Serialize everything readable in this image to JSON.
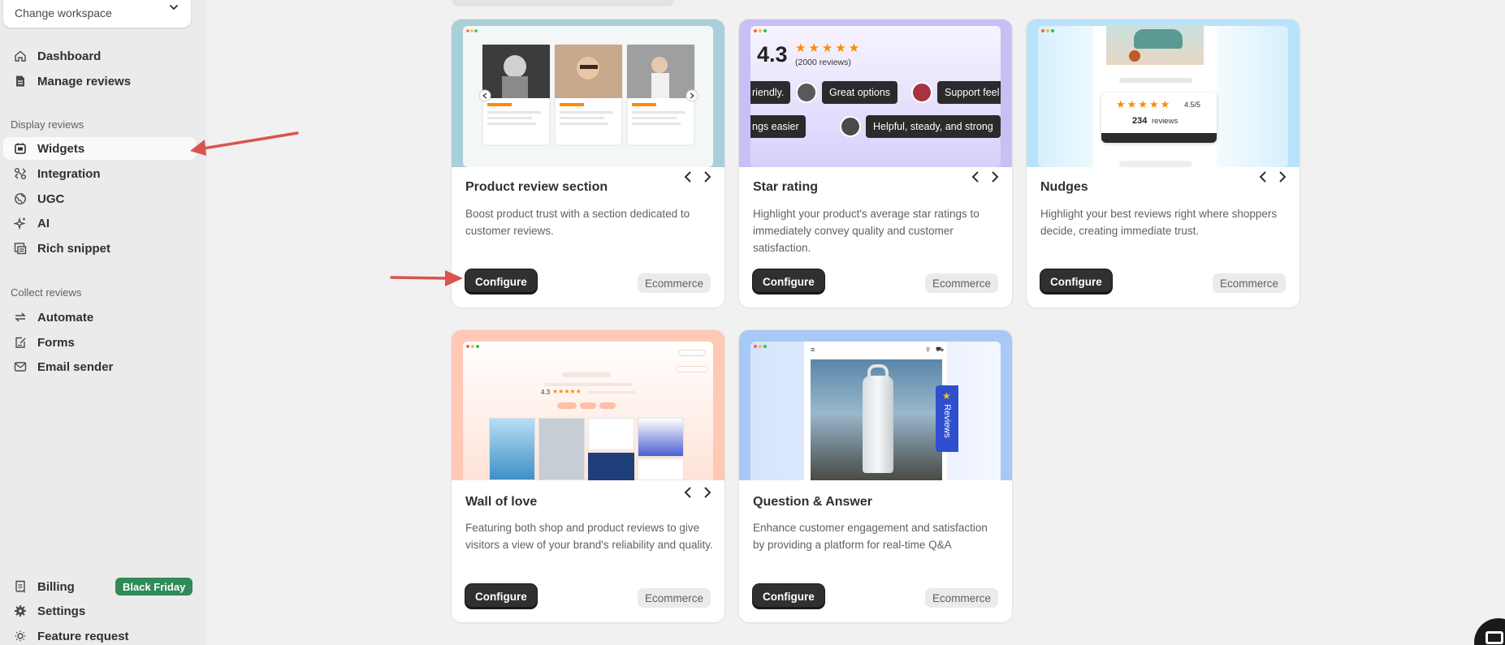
{
  "workspace": {
    "label": "Change workspace"
  },
  "sidebar": {
    "items_top": [
      {
        "label": "Dashboard",
        "icon": "home-icon"
      },
      {
        "label": "Manage reviews",
        "icon": "document-icon"
      }
    ],
    "display_title": "Display reviews",
    "display_items": [
      {
        "label": "Widgets",
        "icon": "widget-icon"
      },
      {
        "label": "Integration",
        "icon": "integration-icon"
      },
      {
        "label": "UGC",
        "icon": "globe-icon"
      },
      {
        "label": "AI",
        "icon": "sparkle-icon"
      },
      {
        "label": "Rich snippet",
        "icon": "snippet-icon"
      }
    ],
    "collect_title": "Collect reviews",
    "collect_items": [
      {
        "label": "Automate",
        "icon": "automate-icon"
      },
      {
        "label": "Forms",
        "icon": "form-icon"
      },
      {
        "label": "Email sender",
        "icon": "email-icon"
      }
    ],
    "bottom_items": [
      {
        "label": "Billing",
        "icon": "billing-icon"
      },
      {
        "label": "Settings",
        "icon": "gear-icon"
      },
      {
        "label": "Feature request",
        "icon": "lightbulb-icon"
      }
    ],
    "billing_badge": "Black Friday"
  },
  "cards": [
    {
      "title": "Product review section",
      "desc": "Boost product trust with a section dedicated to customer reviews.",
      "button": "Configure",
      "tag": "Ecommerce"
    },
    {
      "title": "Star rating",
      "desc": "Highlight your product's average star ratings to immediately convey quality and customer satisfaction.",
      "button": "Configure",
      "tag": "Ecommerce"
    },
    {
      "title": "Nudges",
      "desc": "Highlight your best reviews right where shoppers decide, creating immediate trust.",
      "button": "Configure",
      "tag": "Ecommerce"
    },
    {
      "title": "Wall of love",
      "desc": "Featuring both shop and product reviews to give visitors a view of your brand's reliability and quality.",
      "button": "Configure",
      "tag": "Ecommerce"
    },
    {
      "title": "Question & Answer",
      "desc": "Enhance customer engagement and satisfaction by providing a platform for real-time Q&A",
      "button": "Configure",
      "tag": "Ecommerce"
    }
  ],
  "previews": {
    "star_rating": {
      "score": "4.3",
      "count": "(2000 reviews)",
      "chips": [
        "riendly.",
        "Great options",
        "Support feel",
        "ngs easier",
        "Helpful, steady, and strong"
      ]
    },
    "nudges": {
      "score": "4.5/5",
      "count": "234",
      "count_label": "reviews"
    },
    "wall": {
      "score": "4.3"
    },
    "qa": {
      "tab": "Reviews"
    }
  },
  "colors": {
    "primary_button": "#303030",
    "badge_green": "#2e8b57",
    "star": "#ff8a00",
    "arrow_red": "#d9534f"
  }
}
